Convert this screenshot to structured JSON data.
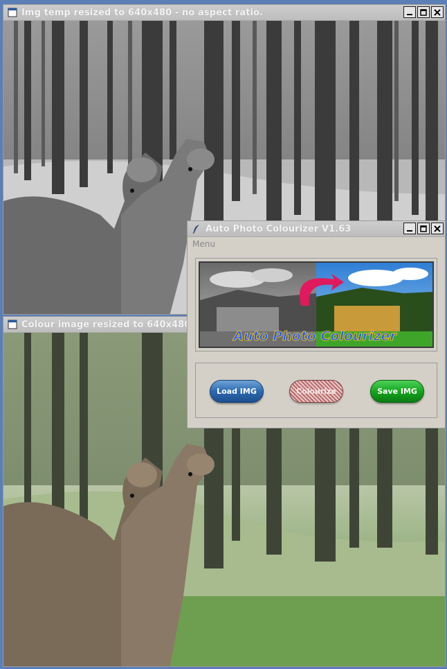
{
  "windows": {
    "grey": {
      "title": "Img temp resized to 640x480 - no aspect ratio."
    },
    "colour": {
      "title": "Colour image resized to 640x480. C"
    },
    "app": {
      "title": "Auto Photo Colourizer V1.63",
      "menu_label": "Menu",
      "banner_text": "Auto Photo Colourizer",
      "buttons": {
        "load": "Load IMG",
        "colourize": "Colourize",
        "save": "Save IMG"
      }
    }
  },
  "icons": {
    "window_icon": "window-icon",
    "app_icon": "feather-quill-icon",
    "minimize": "minimize-icon",
    "maximize": "maximize-icon",
    "close": "close-icon"
  }
}
